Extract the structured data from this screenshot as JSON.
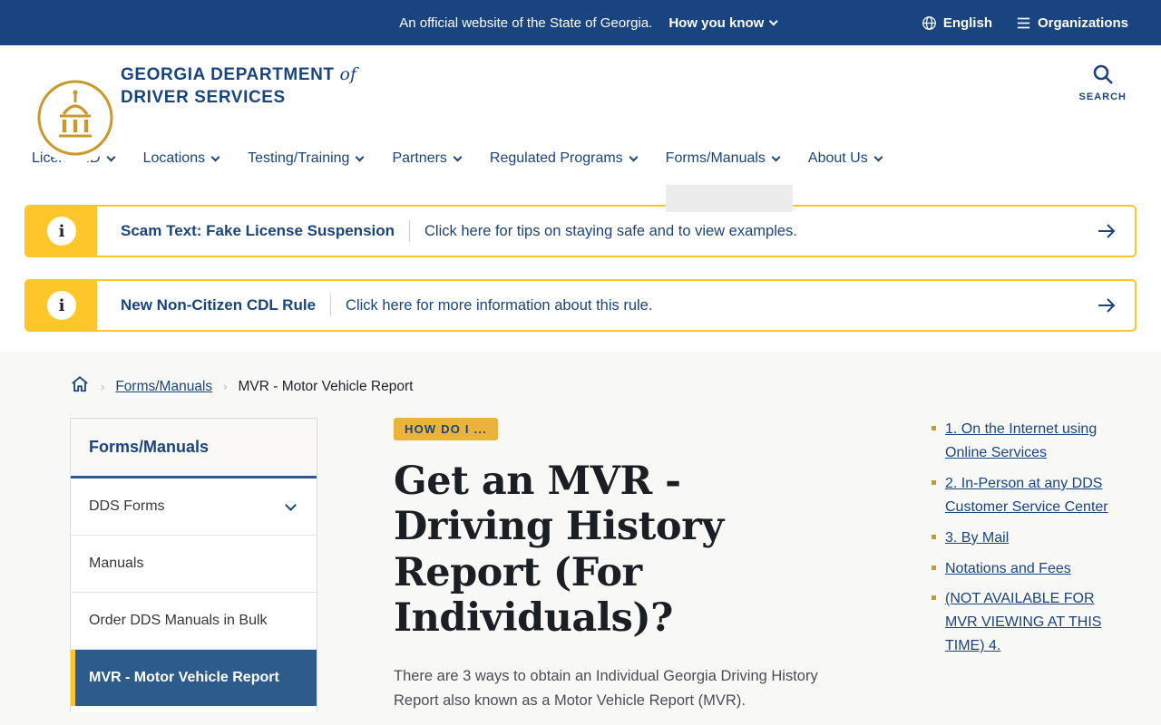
{
  "colors": {
    "navy": "#1a4480",
    "gold": "#ffc629",
    "active_blue": "#2e5c8a",
    "badge_gold": "#eab43c",
    "page_gray": "#f8f8f7"
  },
  "topbar": {
    "official_text": "An official website of the State of Georgia.",
    "how_you_know": "How you know",
    "language": "English",
    "organizations": "Organizations"
  },
  "header": {
    "agency_line1": "GEORGIA DEPARTMENT",
    "agency_of": "of",
    "agency_line2": "DRIVER SERVICES",
    "search_label": "SEARCH"
  },
  "nav": {
    "items": [
      {
        "label": "License/ID"
      },
      {
        "label": "Locations"
      },
      {
        "label": "Testing/Training"
      },
      {
        "label": "Partners"
      },
      {
        "label": "Regulated Programs"
      },
      {
        "label": "Forms/Manuals",
        "active": true
      },
      {
        "label": "About Us"
      }
    ]
  },
  "alerts": [
    {
      "title": "Scam Text: Fake License Suspension",
      "link_text": "Click here for tips on staying safe and to view examples."
    },
    {
      "title": "New Non-Citizen CDL Rule",
      "link_text": "Click here for more information about this rule."
    }
  ],
  "breadcrumb": {
    "link": "Forms/Manuals",
    "current": "MVR - Motor Vehicle Report"
  },
  "sidebar": {
    "title": "Forms/Manuals",
    "items": [
      {
        "label": "DDS Forms",
        "expandable": true
      },
      {
        "label": "Manuals"
      },
      {
        "label": "Order DDS Manuals in Bulk"
      },
      {
        "label": "MVR - Motor Vehicle Report",
        "active": true
      }
    ]
  },
  "main": {
    "badge": "HOW DO I ...",
    "title": "Get an MVR - Driving History Report (For Individuals)?",
    "intro": "There are 3 ways to obtain an Individual Georgia Driving History Report also known as a Motor Vehicle Report (MVR)."
  },
  "toc": {
    "links": [
      "1. On the Internet using Online Services",
      "2. In-Person at any DDS Customer Service Center",
      "3. By Mail",
      "Notations and Fees",
      "(NOT AVAILABLE FOR MVR VIEWING AT THIS TIME) 4."
    ]
  }
}
